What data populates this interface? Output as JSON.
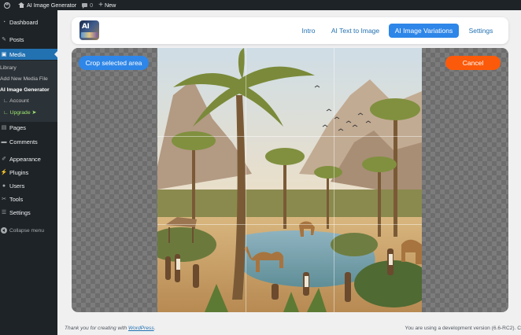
{
  "adminbar": {
    "site_name": "AI Image Generator",
    "comments_count": "0",
    "new_label": "New"
  },
  "sidebar": {
    "items": [
      {
        "label": "Dashboard",
        "icon": "dashboard-icon"
      },
      {
        "label": "Posts",
        "icon": "pin-icon"
      },
      {
        "label": "Media",
        "icon": "media-icon",
        "current": true
      },
      {
        "label": "Pages",
        "icon": "page-icon"
      },
      {
        "label": "Comments",
        "icon": "comment-icon"
      },
      {
        "label": "Appearance",
        "icon": "brush-icon"
      },
      {
        "label": "Plugins",
        "icon": "plug-icon"
      },
      {
        "label": "Users",
        "icon": "user-icon"
      },
      {
        "label": "Tools",
        "icon": "wrench-icon"
      },
      {
        "label": "Settings",
        "icon": "sliders-icon"
      }
    ],
    "submenu": {
      "library": "Library",
      "add_new": "Add New Media File",
      "ai_image_generator": "AI Image Generator",
      "account": "Account",
      "upgrade": "Upgrade"
    },
    "collapse_label": "Collapse menu"
  },
  "plugin_nav": {
    "tabs": [
      "Intro",
      "AI Text to Image",
      "AI Image Variations",
      "Settings"
    ],
    "active_tab": "AI Image Variations"
  },
  "crop": {
    "crop_button": "Crop selected area",
    "cancel_button": "Cancel"
  },
  "footer": {
    "thanks_prefix": "Thank you for creating with",
    "wordpress_link": "WordPress",
    "thanks_suffix": ".",
    "version_text": "You are using a development version (6.6-RC2). C"
  },
  "colors": {
    "wp_blue": "#2271b1",
    "accent_blue": "#2e86e8",
    "cancel_orange": "#fb5a0a",
    "admin_dark": "#1d2327"
  }
}
